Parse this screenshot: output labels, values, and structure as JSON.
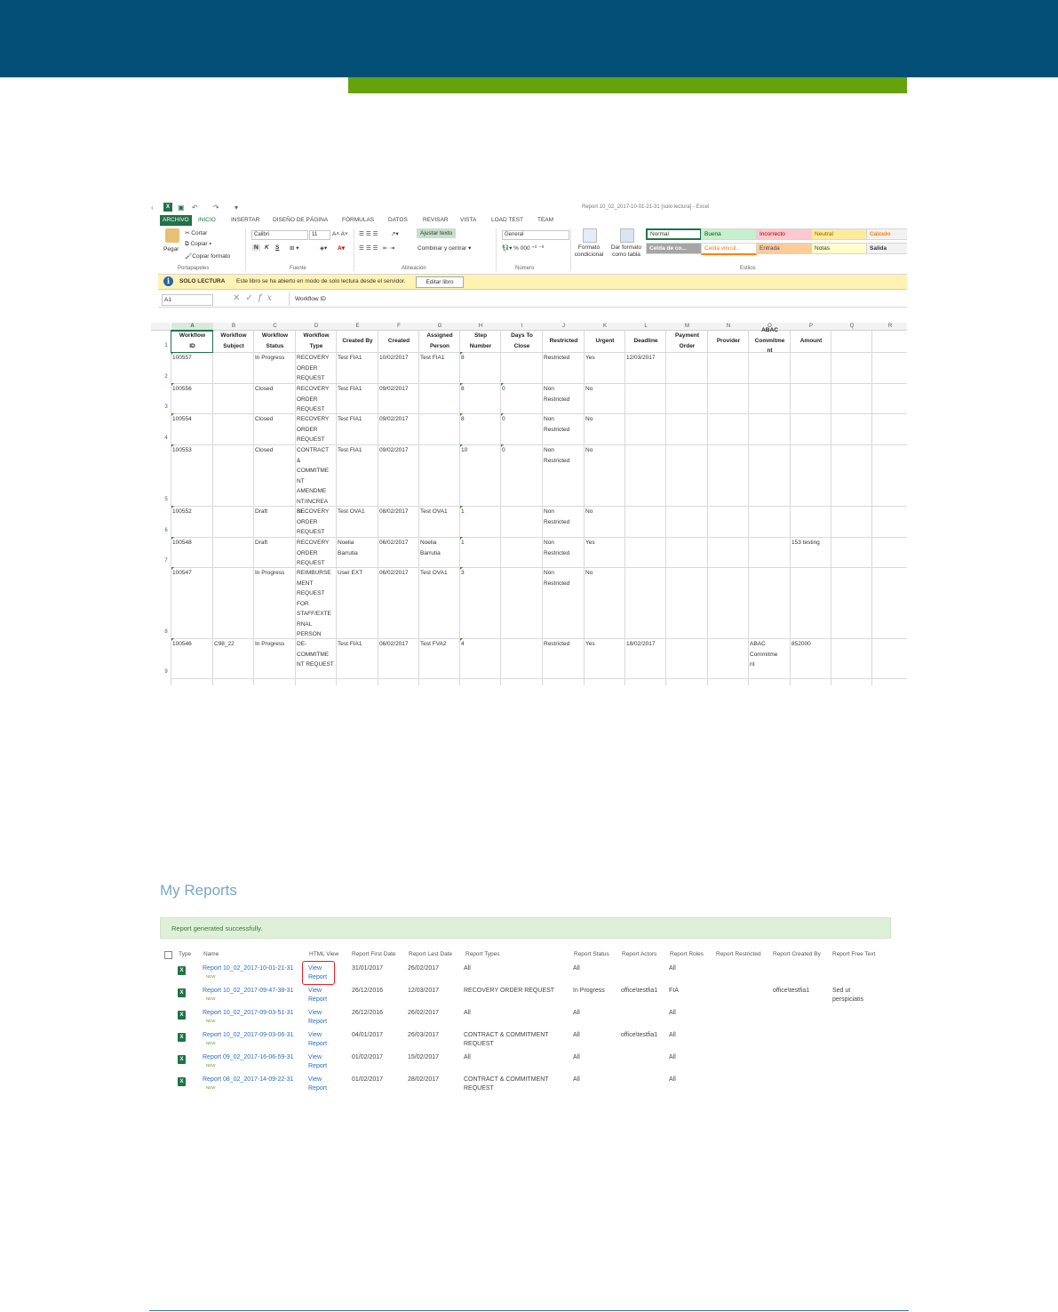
{
  "excel": {
    "window_title": "Report 10_02_2017-10-01-21-31  [solo lectura] - Excel",
    "ribbon_tabs": [
      "ARCHIVO",
      "INICIO",
      "INSERTAR",
      "DISEÑO DE PÁGINA",
      "FÓRMULAS",
      "DATOS",
      "REVISAR",
      "VISTA",
      "LOAD TEST",
      "TEAM"
    ],
    "ribbon": {
      "paste": "Pegar",
      "cut": "Cortar",
      "copy": "Copiar",
      "format_painter": "Copiar formato",
      "font_name": "Calibri",
      "font_size": "11",
      "bold": "N",
      "italic": "K",
      "underline": "S",
      "wrap_text": "Ajustar texto",
      "merge_center": "Combinar y centrar",
      "number_format": "General",
      "conditional_format": "Formato condicional",
      "format_as_table": "Dar formato como tabla",
      "styles": [
        "Normal",
        "Buena",
        "Incorrecto",
        "Neutral",
        "Cálculo",
        "Celda de co...",
        "Celda vincul...",
        "Entrada",
        "Notas",
        "Salida"
      ],
      "group_labels": [
        "Portapapeles",
        "Fuente",
        "Alineación",
        "Número",
        "Estilos"
      ]
    },
    "info_bar": {
      "label": "SOLO LECTURA",
      "message": "Este libro se ha abierto en modo de solo lectura desde el servidor.",
      "button": "Editar libro"
    },
    "name_box": "A1",
    "formula": "Workflow ID",
    "column_letters": [
      "A",
      "B",
      "C",
      "D",
      "E",
      "F",
      "G",
      "H",
      "I",
      "J",
      "K",
      "L",
      "M",
      "N",
      "O",
      "P",
      "Q",
      "R"
    ],
    "headers": [
      "Workflow ID",
      "Workflow Subject",
      "Workflow Status",
      "Workflow Type",
      "Created By",
      "Created",
      "Assigned Person",
      "Step Number",
      "Days To Close",
      "Restricted",
      "Urgent",
      "Deadline",
      "Payment Order",
      "Provider",
      "ABAC Commitment",
      "Amount"
    ],
    "header_display": [
      "Workflow\nID",
      "Workflow\nSubject",
      "Workflow\nStatus",
      "Workflow\nType",
      "Created By",
      "Created",
      "Assigned\nPerson",
      "Step\nNumber",
      "Days To\nClose",
      "Restricted",
      "Urgent",
      "Deadline",
      "Payment\nOrder",
      "Provider",
      "ABAC\nCommitme\nnt",
      "Amount"
    ],
    "row_numbers": [
      "1",
      "2",
      "3",
      "4",
      "5",
      "6",
      "7",
      "8",
      "9"
    ],
    "rows": [
      [
        "100557",
        "",
        "In Progress",
        "RECOVERY\nORDER\nREQUEST",
        "Test FIA1",
        "10/02/2017",
        "Test FIA1",
        "8",
        "",
        "Restricted",
        "Yes",
        "12/03/2017",
        "",
        "",
        "",
        ""
      ],
      [
        "100556",
        "",
        "Closed",
        "RECOVERY\nORDER\nREQUEST",
        "Test FIA1",
        "09/02/2017",
        "",
        "8",
        "0",
        "Non\nRestricted",
        "No",
        "",
        "",
        "",
        "",
        ""
      ],
      [
        "100554",
        "",
        "Closed",
        "RECOVERY\nORDER\nREQUEST",
        "Test FIA1",
        "09/02/2017",
        "",
        "8",
        "0",
        "Non\nRestricted",
        "No",
        "",
        "",
        "",
        "",
        ""
      ],
      [
        "100553",
        "",
        "Closed",
        "CONTRACT\n&\nCOMMITME\nNT\nAMENDME\nNT/INCREA\nSE",
        "Test FIA1",
        "09/02/2017",
        "",
        "10",
        "0",
        "Non\nRestricted",
        "No",
        "",
        "",
        "",
        "",
        ""
      ],
      [
        "100552",
        "",
        "Draft",
        "RECOVERY\nORDER\nREQUEST",
        "Test OVA1",
        "08/02/2017",
        "Test OVA1",
        "1",
        "",
        "Non\nRestricted",
        "No",
        "",
        "",
        "",
        "",
        ""
      ],
      [
        "100548",
        "",
        "Draft",
        "RECOVERY\nORDER\nREQUEST",
        "Noelia\nBarrutia",
        "06/02/2017",
        "Noelia\nBarrutia",
        "1",
        "",
        "Non\nRestricted",
        "Yes",
        "",
        "",
        "",
        "",
        "153 testing"
      ],
      [
        "100547",
        "",
        "In Progress",
        "REIMBURSE\nMENT\nREQUEST\nFOR\nSTAFF/EXTE\nRNAL\nPERSON",
        "User EXT",
        "06/02/2017",
        "Test OVA1",
        "3",
        "",
        "Non\nRestricted",
        "No",
        "",
        "",
        "",
        "",
        ""
      ],
      [
        "100546",
        "C98_22",
        "In Progress",
        "DE-\nCOMMITME\nNT REQUEST",
        "Test FIA1",
        "06/02/2017",
        "Test FVA2",
        "4",
        "",
        "Restricted",
        "Yes",
        "18/02/2017",
        "",
        "",
        "ABAC\nCommitme\nnt",
        "852000"
      ]
    ]
  },
  "reports": {
    "title": "My Reports",
    "success_message": "Report generated successfully.",
    "columns": [
      "Type",
      "Name",
      "HTML View",
      "Report First Date",
      "Report Last Date",
      "Report Types",
      "Report Status",
      "Report Actors",
      "Report Roles",
      "Report Restricted",
      "Report Created By",
      "Report Free Text"
    ],
    "new_tag": "NEW",
    "rows": [
      {
        "name": "Report 10_02_2017-10-01-21-31",
        "view": "View\nReport",
        "first": "31/01/2017",
        "last": "26/02/2017",
        "types": "All",
        "status": "All",
        "actors": "",
        "roles": "All",
        "restricted": "",
        "created_by": "",
        "free_text": ""
      },
      {
        "name": "Report 10_02_2017-09-47-38-31",
        "view": "View\nReport",
        "first": "26/12/2016",
        "last": "12/03/2017",
        "types": "RECOVERY ORDER REQUEST",
        "status": "In Progress",
        "actors": "office\\testfia1",
        "roles": "FIA",
        "restricted": "",
        "created_by": "office\\testfia1",
        "free_text": "Sed ut\nperspiciatis"
      },
      {
        "name": "Report 10_02_2017-09-03-51-31",
        "view": "View\nReport",
        "first": "26/12/2016",
        "last": "26/02/2017",
        "types": "All",
        "status": "All",
        "actors": "",
        "roles": "All",
        "restricted": "",
        "created_by": "",
        "free_text": ""
      },
      {
        "name": "Report 10_02_2017-09-03-06-31",
        "view": "View\nReport",
        "first": "04/01/2017",
        "last": "26/03/2017",
        "types": "CONTRACT & COMMITMENT\nREQUEST",
        "status": "All",
        "actors": "office\\testfia1",
        "roles": "All",
        "restricted": "",
        "created_by": "",
        "free_text": ""
      },
      {
        "name": "Report 09_02_2017-16-06-59-31",
        "view": "View\nReport",
        "first": "01/02/2017",
        "last": "15/02/2017",
        "types": "All",
        "status": "All",
        "actors": "",
        "roles": "All",
        "restricted": "",
        "created_by": "",
        "free_text": ""
      },
      {
        "name": "Report 08_02_2017-14-09-22-31",
        "view": "View\nReport",
        "first": "01/02/2017",
        "last": "28/02/2017",
        "types": "CONTRACT & COMMITMENT\nREQUEST",
        "status": "All",
        "actors": "",
        "roles": "All",
        "restricted": "",
        "created_by": "",
        "free_text": ""
      }
    ]
  },
  "colors": {
    "header_band": "#034e76",
    "accent_band": "#65a30d",
    "excel_green": "#217346",
    "link": "#2a6ebb",
    "highlight": "#d9232d"
  }
}
